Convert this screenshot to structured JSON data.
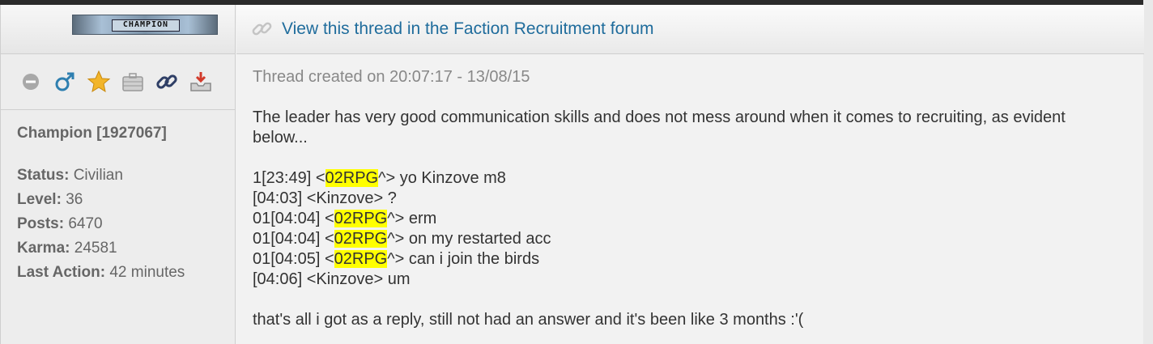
{
  "profile": {
    "banner_text": "CHAMPION",
    "username": "Champion [1927067]",
    "stats": [
      {
        "label": "Status:",
        "value": "Civilian"
      },
      {
        "label": "Level:",
        "value": "36"
      },
      {
        "label": "Posts:",
        "value": "6470"
      },
      {
        "label": "Karma:",
        "value": "24581"
      },
      {
        "label": "Last Action:",
        "value": "42 minutes"
      }
    ],
    "icons": [
      "offline-status-icon",
      "male-icon",
      "star-icon",
      "briefcase-icon",
      "chain-link-icon",
      "inbox-icon"
    ]
  },
  "thread": {
    "forum_link": "View this thread in the Faction Recruitment forum",
    "created": "Thread created on 20:07:17 - 13/08/15",
    "intro": "The leader has very good communication skills and does not mess around when it comes to recruiting, as evident below...",
    "chat": [
      {
        "pre": "1[23:49] <",
        "hl": "02RPG",
        "post": "^> yo Kinzove m8"
      },
      {
        "pre": "[04:03] <Kinzove> ?",
        "hl": "",
        "post": ""
      },
      {
        "pre": "01[04:04] <",
        "hl": "02RPG",
        "post": "^> erm"
      },
      {
        "pre": "01[04:04] <",
        "hl": "02RPG",
        "post": "^> on my restarted acc"
      },
      {
        "pre": "01[04:05] <",
        "hl": "02RPG",
        "post": "^> can i join the birds"
      },
      {
        "pre": "[04:06] <Kinzove> um",
        "hl": "",
        "post": ""
      }
    ],
    "outro": "that's all i got as a reply, still not had an answer and it's been like 3 months :'("
  },
  "colors": {
    "link": "#1f6c9c",
    "highlight": "#ffff00",
    "muted_text": "#888888"
  }
}
